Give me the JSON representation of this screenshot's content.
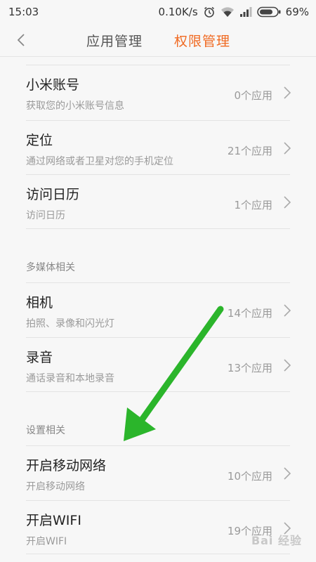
{
  "status_bar": {
    "time": "15:03",
    "speed": "0.10K/s",
    "battery_percent": "69%",
    "icons": [
      "alarm-icon",
      "wifi-icon",
      "signal-icon",
      "battery-icon"
    ]
  },
  "header": {
    "tab_app": "应用管理",
    "tab_permission": "权限管理"
  },
  "rows": [
    {
      "title": "小米账号",
      "subtitle": "获取您的小米账号信息",
      "count": "0个应用"
    },
    {
      "title": "定位",
      "subtitle": "通过网络或者卫星对您的手机定位",
      "count": "21个应用"
    },
    {
      "title": "访问日历",
      "subtitle": "访问日历",
      "count": "1个应用"
    },
    {
      "title": "相机",
      "subtitle": "拍照、录像和闪光灯",
      "count": "14个应用"
    },
    {
      "title": "录音",
      "subtitle": "通话录音和本地录音",
      "count": "13个应用"
    },
    {
      "title": "开启移动网络",
      "subtitle": "开启移动网络",
      "count": "10个应用"
    },
    {
      "title": "开启WIFI",
      "subtitle": "开启WIFI",
      "count": "19个应用"
    }
  ],
  "sections": {
    "multimedia": "多媒体相关",
    "settings": "设置相关"
  },
  "watermark": "Bai 经验",
  "colors": {
    "accent": "#f06a22",
    "annotation_arrow": "#2bb52b"
  }
}
